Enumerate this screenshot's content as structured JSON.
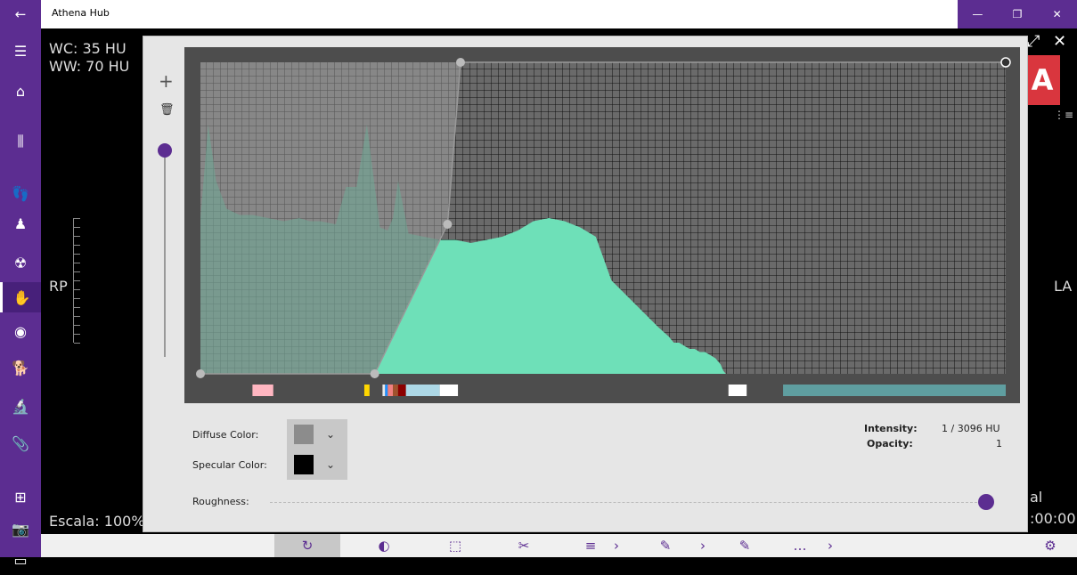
{
  "window": {
    "title": "Athena Hub",
    "back_icon": "←",
    "minimize_icon": "—",
    "restore_icon": "❐",
    "close_icon": "✕"
  },
  "sidebar": {
    "items": [
      {
        "name": "menu-icon",
        "glyph": "☰"
      },
      {
        "name": "home-icon",
        "glyph": "⌂"
      },
      {
        "name": "library-icon",
        "glyph": "⫼"
      },
      {
        "name": "feet-icon",
        "glyph": "👣"
      },
      {
        "name": "body-icon",
        "glyph": "♟"
      },
      {
        "name": "radiation-icon",
        "glyph": "☢"
      },
      {
        "name": "hand-icon",
        "glyph": "✋"
      },
      {
        "name": "brain-icon",
        "glyph": "◉"
      },
      {
        "name": "animal-icon",
        "glyph": "🐕"
      },
      {
        "name": "microscope-icon",
        "glyph": "🔬"
      },
      {
        "name": "attachment-icon",
        "glyph": "📎"
      },
      {
        "name": "windows-icon",
        "glyph": "⊞"
      },
      {
        "name": "camera-icon",
        "glyph": "📷"
      },
      {
        "name": "more-icon",
        "glyph": "▭"
      }
    ]
  },
  "viewer": {
    "wc": "WC: 35 HU",
    "ww": "WW: 70 HU",
    "rp": "RP",
    "la": "LA",
    "scale": "Escala: 100%",
    "al": "al",
    "time": ":00:00",
    "cube_letter": "A"
  },
  "dialog": {
    "add_icon": "+",
    "trash_icon": "🗑",
    "expand_icon": "⤢",
    "close_icon": "✕",
    "diffuse_label": "Diffuse Color:",
    "specular_label": "Specular Color:",
    "roughness_label": "Roughness:",
    "diffuse_color": "#8c8c8c",
    "specular_color": "#000000",
    "intensity_label": "Intensity:",
    "intensity_value": "1 / 3096 HU",
    "opacity_label": "Opacity:",
    "opacity_value": "1",
    "chevron": "⌄",
    "roughness_level": 1.0,
    "slider_level": 1.0
  },
  "chart_data": {
    "type": "area",
    "xlim": [
      0,
      3096
    ],
    "ylim": [
      0,
      1
    ],
    "histogram_x": [
      0,
      30,
      60,
      100,
      150,
      200,
      260,
      320,
      380,
      420,
      460,
      520,
      560,
      600,
      640,
      690,
      720,
      740,
      760,
      800,
      860,
      920,
      980,
      1040,
      1100,
      1160,
      1220,
      1280,
      1340,
      1400,
      1460,
      1520,
      1580,
      1640,
      1700,
      1760,
      1800,
      1820,
      1840,
      1860,
      1880,
      1900,
      1920,
      1940,
      1960,
      1980,
      2000,
      2010,
      2020
    ],
    "histogram_y": [
      0.5,
      0.8,
      0.62,
      0.53,
      0.51,
      0.51,
      0.5,
      0.49,
      0.5,
      0.49,
      0.49,
      0.48,
      0.6,
      0.6,
      0.8,
      0.47,
      0.46,
      0.5,
      0.62,
      0.45,
      0.44,
      0.43,
      0.43,
      0.42,
      0.43,
      0.44,
      0.46,
      0.49,
      0.5,
      0.49,
      0.47,
      0.44,
      0.3,
      0.25,
      0.2,
      0.15,
      0.12,
      0.1,
      0.1,
      0.09,
      0.08,
      0.08,
      0.07,
      0.07,
      0.06,
      0.05,
      0.03,
      0.01,
      0
    ],
    "opacity_points_x": [
      0,
      670,
      950,
      1000,
      3096
    ],
    "opacity_points_y": [
      0,
      0,
      0.48,
      1,
      1
    ],
    "color_stops": [
      {
        "from": 200,
        "to": 280,
        "color": "#ffb6c1"
      },
      {
        "from": 630,
        "to": 650,
        "color": "#ffd700"
      },
      {
        "from": 700,
        "to": 710,
        "color": "#e8e8e8"
      },
      {
        "from": 710,
        "to": 720,
        "color": "#1e90ff"
      },
      {
        "from": 720,
        "to": 740,
        "color": "#f08080"
      },
      {
        "from": 740,
        "to": 760,
        "color": "#a0522d"
      },
      {
        "from": 760,
        "to": 790,
        "color": "#8b0000"
      },
      {
        "from": 790,
        "to": 920,
        "color": "#add8e6"
      },
      {
        "from": 920,
        "to": 990,
        "color": "#ffffff"
      },
      {
        "from": 2030,
        "to": 2100,
        "color": "#ffffff"
      },
      {
        "from": 2240,
        "to": 3096,
        "color": "#5f9ea0"
      }
    ]
  },
  "toolbar": {
    "items": [
      {
        "name": "rotate-icon",
        "glyph": "↻"
      },
      {
        "name": "contrast-icon",
        "glyph": "◐"
      },
      {
        "name": "cube-icon",
        "glyph": "⬚"
      },
      {
        "name": "cut-icon",
        "glyph": "✂"
      },
      {
        "name": "list-icon",
        "glyph": "≡"
      },
      {
        "name": "chevron-right-icon",
        "glyph": "›"
      },
      {
        "name": "ruler-icon",
        "glyph": "✎"
      },
      {
        "name": "chevron-right-icon",
        "glyph": "›"
      },
      {
        "name": "pencil-icon",
        "glyph": "✎"
      },
      {
        "name": "more-icon",
        "glyph": "…"
      },
      {
        "name": "chevron-right-icon",
        "glyph": "›"
      },
      {
        "name": "settings-icon",
        "glyph": "⚙"
      }
    ]
  }
}
